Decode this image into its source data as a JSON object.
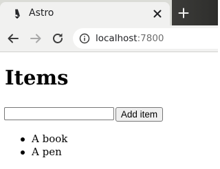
{
  "browser": {
    "tab": {
      "title": "Astro",
      "favicon": "astro-logo-icon"
    },
    "toolbar": {
      "url_host": "localhost",
      "url_port": ":7800",
      "back_icon": "arrow-left-icon",
      "forward_icon": "arrow-right-icon",
      "reload_icon": "reload-icon",
      "info_icon": "info-icon"
    },
    "colors": {
      "tab_strip": "#dbdcd7",
      "tab_active": "#f1f1f0",
      "titlebar_dark": "#2e2e2c"
    }
  },
  "page": {
    "title": "Items",
    "input": {
      "value": "",
      "placeholder": ""
    },
    "add_button_label": "Add item",
    "items": [
      {
        "label": "A book"
      },
      {
        "label": "A pen"
      }
    ]
  }
}
